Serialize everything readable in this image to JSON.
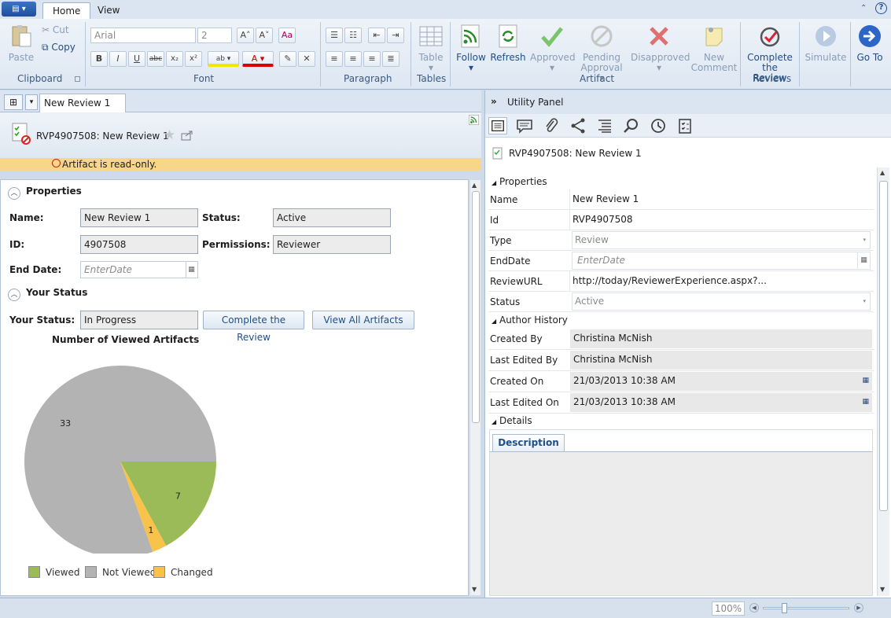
{
  "ribbon": {
    "tabs": [
      "Home",
      "View"
    ],
    "clipboard": {
      "paste": "Paste",
      "cut": "Cut",
      "copy": "Copy",
      "label": "Clipboard"
    },
    "font": {
      "name": "Arial",
      "size": "2",
      "label": "Font"
    },
    "paragraph": {
      "label": "Paragraph"
    },
    "tables": {
      "table": "Table",
      "label": "Tables"
    },
    "artifact": {
      "follow": "Follow",
      "refresh": "Refresh",
      "approved": "Approved",
      "pending1": "Pending",
      "pending2": "Approval",
      "disapproved": "Disapproved",
      "newcomment1": "New",
      "newcomment2": "Comment",
      "label": "Artifact"
    },
    "reviews": {
      "complete1": "Complete",
      "complete2": "the Review",
      "label": "Reviews"
    },
    "simulate": "Simulate",
    "goto": "Go To"
  },
  "left": {
    "tab": "New Review 1",
    "header_title": "RVP4907508: New Review 1",
    "readonly": "Artifact is read-only.",
    "properties": {
      "title": "Properties",
      "name_label": "Name:",
      "name_value": "New Review 1",
      "status_label": "Status:",
      "status_value": "Active",
      "id_label": "ID:",
      "id_value": "4907508",
      "perm_label": "Permissions:",
      "perm_value": "Reviewer",
      "end_label": "End Date:",
      "end_placeholder": "EnterDate"
    },
    "status": {
      "title": "Your Status",
      "label": "Your Status:",
      "value": "In Progress",
      "complete_button": "Complete the Review",
      "viewall_button": "View All Artifacts"
    }
  },
  "chart_data": {
    "type": "pie",
    "title": "Number of Viewed Artifacts",
    "slices": [
      {
        "name": "Viewed",
        "value": 7,
        "color": "#9bbb59"
      },
      {
        "name": "Changed",
        "value": 1,
        "color": "#f9c24a"
      },
      {
        "name": "Not Viewed",
        "value": 33,
        "color": "#b3b3b3"
      }
    ],
    "legend": [
      "Viewed",
      "Not Viewed",
      "Changed"
    ],
    "legend_position": "bottom"
  },
  "right": {
    "panel_title": "Utility Panel",
    "artifact_title": "RVP4907508: New Review 1",
    "properties_title": "Properties",
    "rows": [
      {
        "label": "Name",
        "value": "New Review 1"
      },
      {
        "label": "Id",
        "value": "RVP4907508"
      },
      {
        "label": "Type",
        "value": "Review"
      },
      {
        "label": "EndDate",
        "value": "EnterDate"
      },
      {
        "label": "ReviewURL",
        "value": "http://today/ReviewerExperience.aspx?..."
      },
      {
        "label": "Status",
        "value": "Active"
      }
    ],
    "author_title": "Author History",
    "author_rows": [
      {
        "label": "Created By",
        "value": "Christina McNish"
      },
      {
        "label": "Last Edited By",
        "value": "Christina McNish"
      },
      {
        "label": "Created On",
        "value": "21/03/2013 10:38 AM"
      },
      {
        "label": "Last Edited On",
        "value": "21/03/2013 10:38 AM"
      }
    ],
    "details_title": "Details",
    "description_tab": "Description"
  },
  "statusbar": {
    "zoom": "100%"
  }
}
